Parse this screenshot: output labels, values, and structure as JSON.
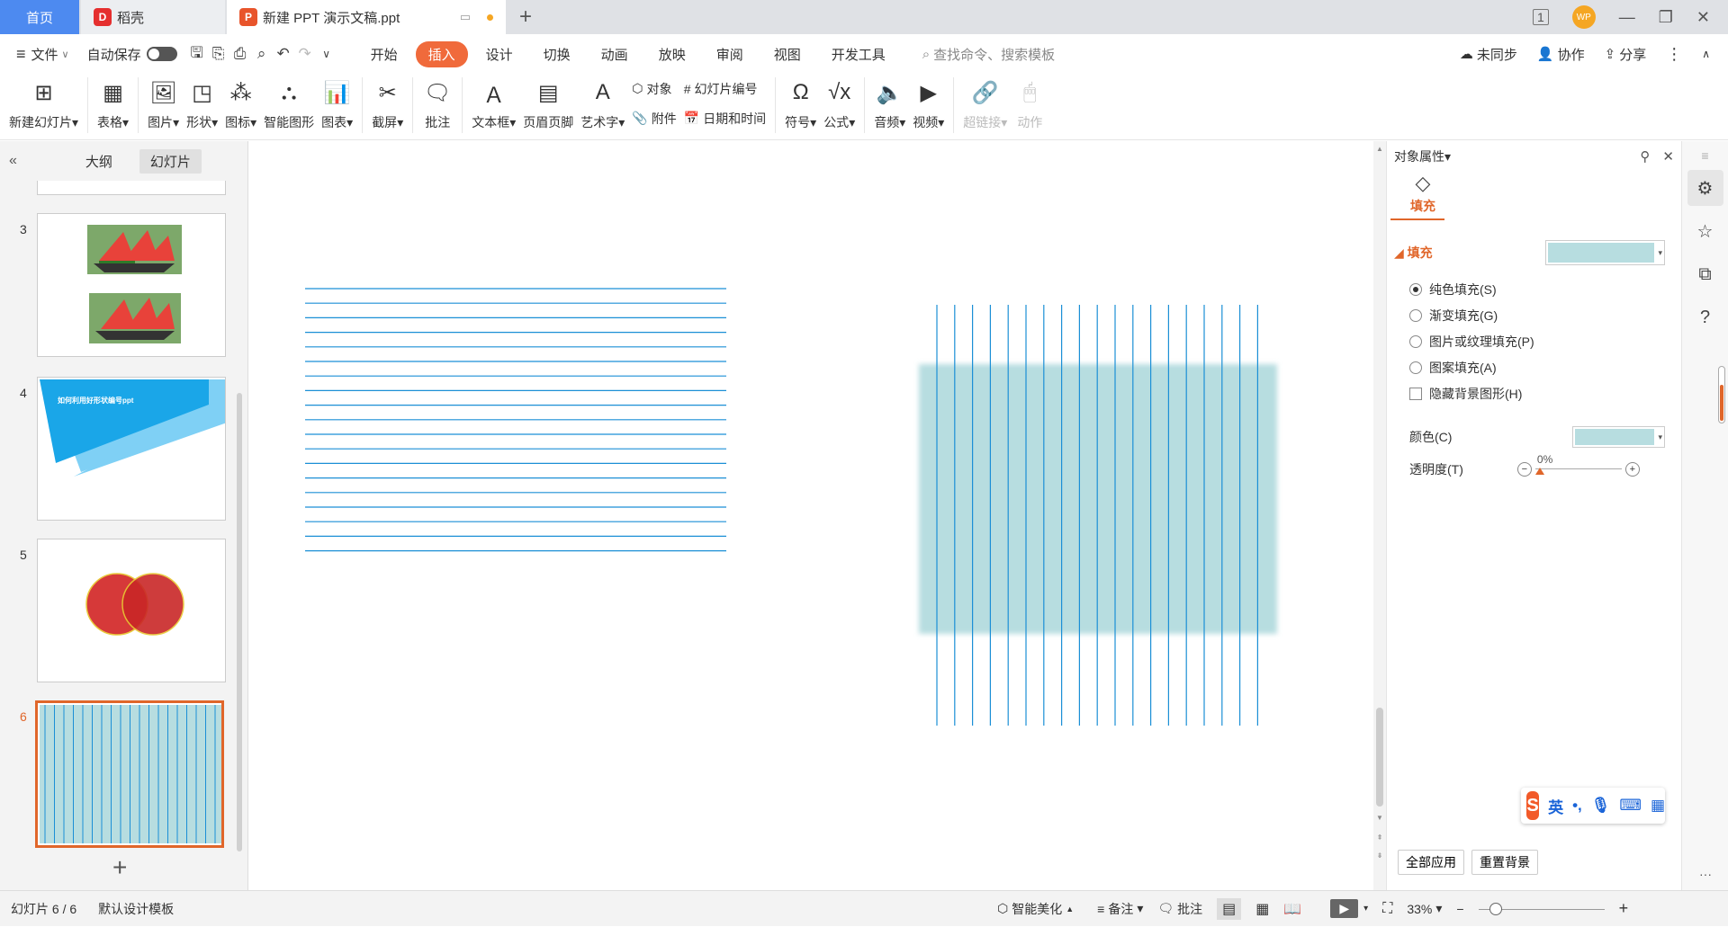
{
  "tabs": {
    "home": "首页",
    "docer": "稻壳",
    "doc": "新建 PPT 演示文稿.ppt",
    "avatar": "WP"
  },
  "menu": {
    "file": "文件",
    "autosave": "自动保存",
    "tabs": [
      "开始",
      "插入",
      "设计",
      "切换",
      "动画",
      "放映",
      "审阅",
      "视图",
      "开发工具"
    ],
    "active_tab": "插入",
    "search_placeholder": "查找命令、搜索模板",
    "sync": "未同步",
    "collab": "协作",
    "share": "分享"
  },
  "ribbon": {
    "new_slide": "新建幻灯片",
    "table": "表格",
    "picture": "图片",
    "shape": "形状",
    "icon": "图标",
    "smartart": "智能图形",
    "chart": "图表",
    "screenshot": "截屏",
    "comment": "批注",
    "textbox": "文本框",
    "header_footer": "页眉页脚",
    "wordart": "艺术字",
    "object": "对象",
    "attachment": "附件",
    "slide_number": "幻灯片编号",
    "datetime": "日期和时间",
    "symbol": "符号",
    "formula": "公式",
    "audio": "音频",
    "video": "视频",
    "hyperlink": "超链接",
    "action": "动作"
  },
  "left_panel": {
    "outline_tab": "大纲",
    "slides_tab": "幻灯片",
    "slides": [
      {
        "num": "3"
      },
      {
        "num": "4",
        "title": "如何利用好形状编号ppt"
      },
      {
        "num": "5"
      },
      {
        "num": "6"
      }
    ]
  },
  "right_panel": {
    "title": "对象属性",
    "fill_tab": "填充",
    "fill_section": "填充",
    "options": [
      "纯色填充(S)",
      "渐变填充(G)",
      "图片或纹理填充(P)",
      "图案填充(A)"
    ],
    "hide_bg": "隐藏背景图形(H)",
    "color_label": "颜色(C)",
    "transparency_label": "透明度(T)",
    "transparency_value": "0%",
    "fill_color": "#b7dde0",
    "apply_all": "全部应用",
    "reset_bg": "重置背景"
  },
  "ime": {
    "lang": "英"
  },
  "status": {
    "slide_info": "幻灯片 6 / 6",
    "template": "默认设计模板",
    "beautify": "智能美化",
    "notes": "备注",
    "comments": "批注",
    "zoom": "33%"
  },
  "colors": {
    "accent": "#f06a3b",
    "line_blue": "#1b8fd6",
    "fill_teal": "#b7dde0"
  }
}
